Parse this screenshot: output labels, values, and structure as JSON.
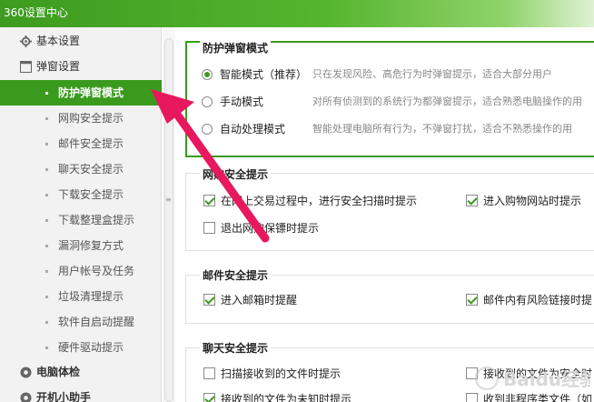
{
  "window": {
    "title": "360设置中心"
  },
  "sidebar": {
    "groups": [
      {
        "label": "基本设置"
      },
      {
        "label": "弹窗设置"
      },
      {
        "label": "电脑体检"
      },
      {
        "label": "开机小助手"
      }
    ],
    "items": [
      {
        "label": "防护弹窗模式"
      },
      {
        "label": "网购安全提示"
      },
      {
        "label": "邮件安全提示"
      },
      {
        "label": "聊天安全提示"
      },
      {
        "label": "下载安全提示"
      },
      {
        "label": "下载整理盒提示"
      },
      {
        "label": "漏洞修复方式"
      },
      {
        "label": "用户帐号及任务"
      },
      {
        "label": "垃圾清理提示"
      },
      {
        "label": "软件自启动提醒"
      },
      {
        "label": "硬件驱动提示"
      }
    ]
  },
  "popup_mode": {
    "title": "防护弹窗模式",
    "options": [
      {
        "label": "智能模式（推荐）",
        "desc": "只在发现风险、高危行为时弹窗提示，适合大部分用户",
        "selected": true
      },
      {
        "label": "手动模式",
        "desc": "对所有侦测到的系统行为都弹窗提示，适合熟悉电脑操作的用",
        "selected": false
      },
      {
        "label": "自动处理模式",
        "desc": "智能处理电脑所有行为，不弹窗打扰，适合不熟悉操作的用",
        "selected": false
      }
    ]
  },
  "shopping": {
    "title": "网购安全提示",
    "options": [
      {
        "label": "在网上交易过程中，进行安全扫描时提示",
        "checked": true
      },
      {
        "label": "进入购物网站时提示",
        "checked": true
      },
      {
        "label": "退出网购保镖时提示",
        "checked": false
      }
    ]
  },
  "mail": {
    "title": "邮件安全提示",
    "options": [
      {
        "label": "进入邮箱时提醒",
        "checked": true
      },
      {
        "label": "邮件内有风险链接时提",
        "checked": true
      }
    ]
  },
  "chat": {
    "title": "聊天安全提示",
    "options": [
      {
        "label": "扫描接收到的文件时提示",
        "checked": false
      },
      {
        "label": "接收到的文件为安全时",
        "checked": false
      },
      {
        "label": "接收到的文件为未知时提示",
        "checked": true
      },
      {
        "label": "收到非程序类文件（如",
        "checked": false
      }
    ]
  },
  "watermark": {
    "text": "Baidu经验"
  },
  "colors": {
    "accent": "#3a9a1e",
    "arrow": "#e8185e"
  }
}
